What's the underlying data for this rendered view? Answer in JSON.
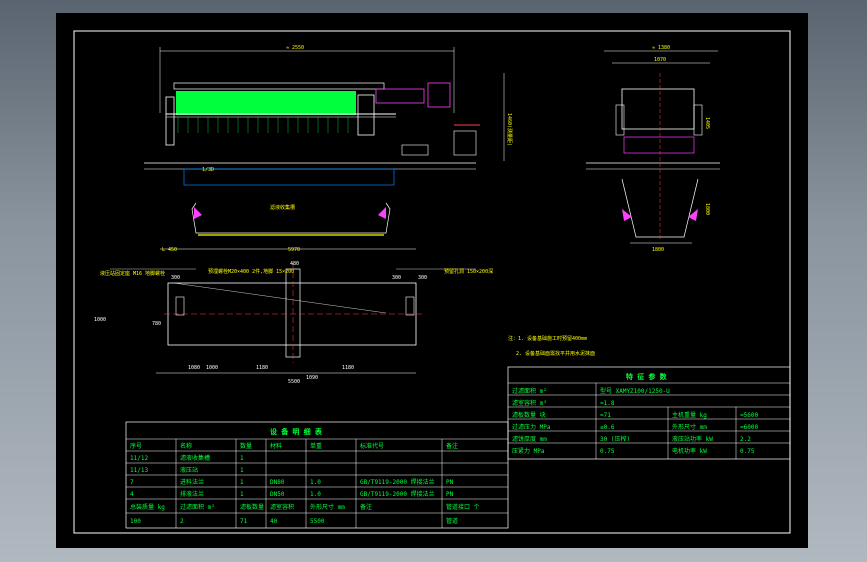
{
  "drawing": {
    "dims_front": {
      "overall_width": "≈ 2550",
      "left_offset": "L 450",
      "total_length": "5970",
      "total_height": "1460(测量距)",
      "side_note": "1/3D"
    },
    "dims_side": {
      "overall": "≈ 1380",
      "top_width": "1070",
      "height_upper": "1405",
      "height_lower": "1800",
      "bottom_width": "1800"
    },
    "dims_plan": {
      "a": "480",
      "b": "300",
      "c": "300",
      "d": "1000",
      "e": "780",
      "f": "1000",
      "g": "1180",
      "h": "1180",
      "i": "1080",
      "j": "5500",
      "k": "300",
      "l": "1090"
    },
    "callouts": {
      "plan_left": "液压站固定座 M16 地脚螺栓",
      "plan_mid": "预埋螺栓M20×400 2件,地脚 15×200",
      "plan_right": "预留孔洞 150×200深",
      "front_mid": "滤液收集槽"
    },
    "notes": {
      "n1": "注：1. 设备基础施工时预留400mm",
      "n2": "2. 设备基础面需找平并用水泥抹面"
    }
  },
  "spec_table": {
    "title": "特 征 参 数",
    "rows": [
      [
        "过滤面积 m²",
        "型号 XAMYZ100/1250-U",
        "",
        ""
      ],
      [
        "滤室容积 m³",
        "≈1.8",
        "",
        ""
      ],
      [
        "滤板数量 块",
        "≈71",
        "主机重量 kg",
        "≈5600"
      ],
      [
        "过滤压力 MPa",
        "≤0.6",
        "外形尺寸 mm",
        "≈6000"
      ],
      [
        "滤饼厚度 mm",
        "30 (压榨)",
        "液压站功率 kW",
        "2.2"
      ],
      [
        "压紧力 MPa",
        "0.75",
        "电机功率 kW",
        "0.75"
      ]
    ]
  },
  "parts_table": {
    "title": "设 备 明 细 表",
    "headers": [
      "序号",
      "名称",
      "数量",
      "材料",
      "单重",
      "标准代号",
      "备注"
    ],
    "rows": [
      [
        "11/12",
        "滤液收集槽",
        "1",
        "",
        "",
        "",
        ""
      ],
      [
        "11/13",
        "液压站",
        "1",
        "",
        "",
        "",
        ""
      ],
      [
        "7",
        "进料法兰",
        "1",
        "DN80",
        "1.0",
        "GB/T9119-2000 焊接法兰",
        "PN"
      ],
      [
        "4",
        "排液法兰",
        "1",
        "DN50",
        "1.0",
        "GB/T9119-2000 焊接法兰",
        "PN"
      ]
    ],
    "footer_headers": [
      "总装质量 kg",
      "过滤面积 m²",
      "滤板数量",
      "滤室容积",
      "外形尺寸 mm",
      "备注",
      "管道接口 个"
    ],
    "footer_values": [
      "100",
      "2",
      "71",
      "40",
      "5500",
      "",
      "管道"
    ]
  }
}
